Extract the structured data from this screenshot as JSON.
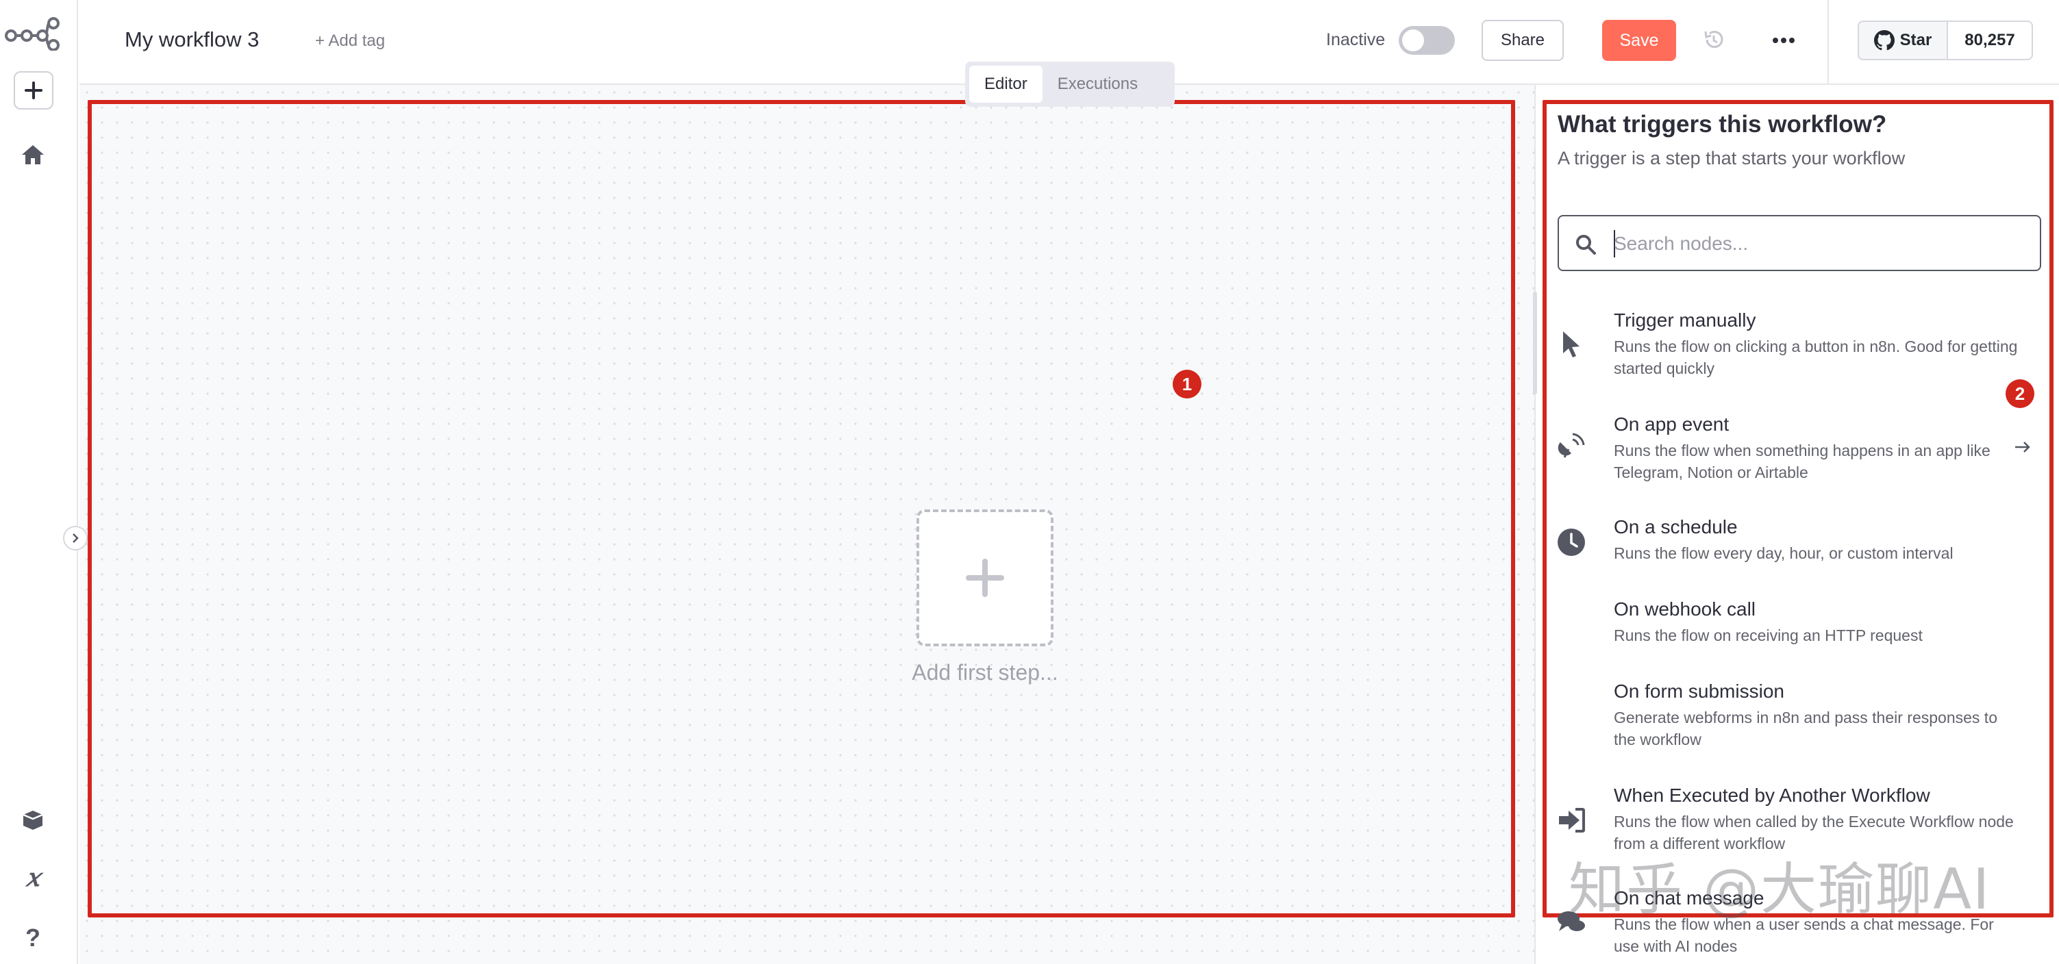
{
  "header": {
    "workflow_title": "My workflow 3",
    "add_tag": "+ Add tag",
    "status_label": "Inactive",
    "share_label": "Share",
    "save_label": "Save",
    "github_star_label": "Star",
    "github_star_count": "80,257"
  },
  "tabs": [
    {
      "label": "Editor",
      "active": true
    },
    {
      "label": "Executions",
      "active": false
    }
  ],
  "canvas": {
    "add_first_step_label": "Add first step...",
    "marker_label": "1"
  },
  "panel": {
    "title": "What triggers this workflow?",
    "subtitle": "A trigger is a step that starts your workflow",
    "search_placeholder": "Search nodes...",
    "marker_label": "2",
    "items": [
      {
        "title": "Trigger manually",
        "description": "Runs the flow on clicking a button in n8n. Good for getting started quickly",
        "icon": "cursor-icon"
      },
      {
        "title": "On app event",
        "description": "Runs the flow when something happens in an app like Telegram, Notion or Airtable",
        "icon": "satellite-icon"
      },
      {
        "title": "On a schedule",
        "description": "Runs the flow every day, hour, or custom interval",
        "icon": "clock-icon"
      },
      {
        "title": "On webhook call",
        "description": "Runs the flow on receiving an HTTP request",
        "icon": "webhook-icon"
      },
      {
        "title": "On form submission",
        "description": "Generate webforms in n8n and pass their responses to the workflow",
        "icon": "form-icon"
      },
      {
        "title": "When Executed by Another Workflow",
        "description": "Runs the flow when called by the Execute Workflow node from a different workflow",
        "icon": "sign-in-icon"
      },
      {
        "title": "On chat message",
        "description": "Runs the flow when a user sends a chat message. For use with AI nodes",
        "icon": "chat-icon"
      }
    ]
  },
  "watermark": "知乎 @大瑜聊AI",
  "colors": {
    "accent": "#ff6d5a",
    "annotation_red": "#d3261c"
  }
}
